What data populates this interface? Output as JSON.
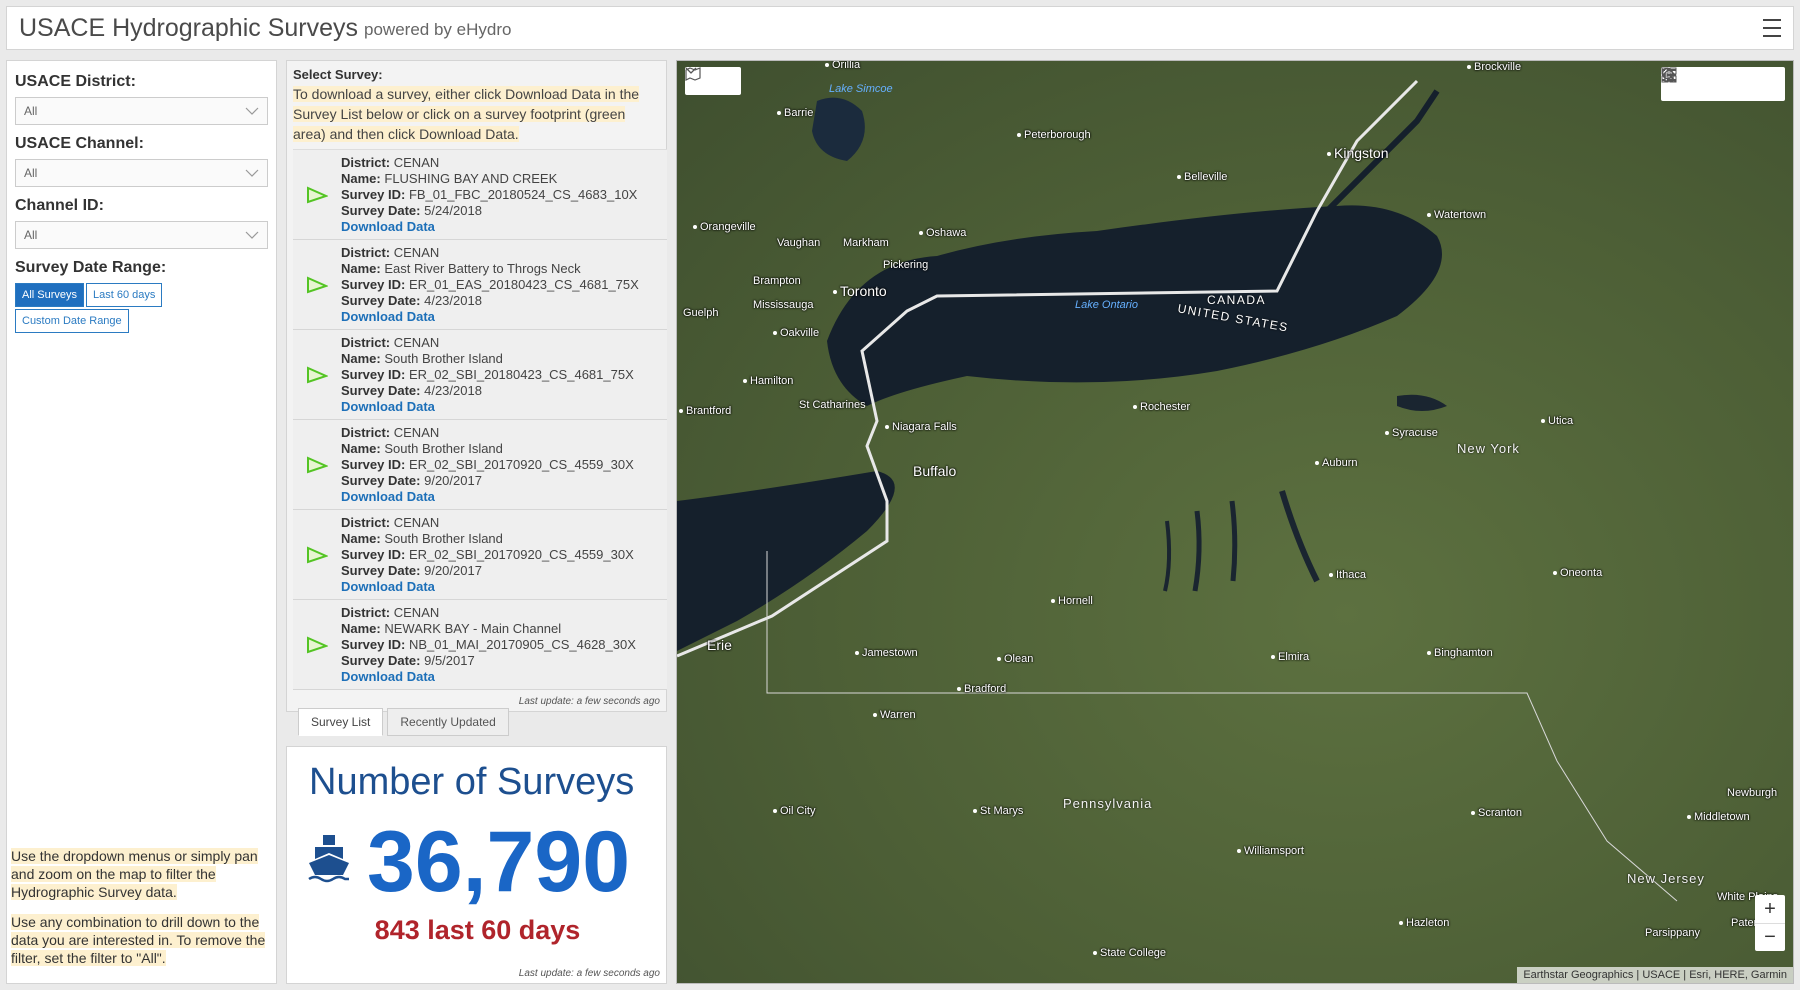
{
  "header": {
    "title": "USACE Hydrographic Surveys",
    "subtitle": "powered by eHydro"
  },
  "filters": {
    "district_label": "USACE District:",
    "district_value": "All",
    "channel_label": "USACE Channel:",
    "channel_value": "All",
    "channel_id_label": "Channel ID:",
    "channel_id_value": "All",
    "date_range_label": "Survey Date Range:",
    "btn_all": "All Surveys",
    "btn_60": "Last 60 days",
    "btn_custom": "Custom Date Range",
    "help1": "Use the dropdown menus or simply pan and zoom on the map to filter the Hydrographic Survey data.",
    "help2": "Use any combination to drill down to the data you are interested in.  To remove the filter, set the filter to \"All\"."
  },
  "survey_panel": {
    "heading": "Select Survey:",
    "instructions": "To download a survey, either click Download Data in the Survey List below or click on a survey footprint (green area) and then click Download Data.",
    "district_key": "District:",
    "name_key": "Name:",
    "id_key": "Survey ID:",
    "date_key": "Survey Date:",
    "download_label": "Download Data",
    "items": [
      {
        "district": "CENAN",
        "name": "FLUSHING BAY AND CREEK",
        "id": "FB_01_FBC_20180524_CS_4683_10X",
        "date": "5/24/2018"
      },
      {
        "district": "CENAN",
        "name": "East River Battery to Throgs Neck",
        "id": "ER_01_EAS_20180423_CS_4681_75X",
        "date": "4/23/2018"
      },
      {
        "district": "CENAN",
        "name": "South Brother Island",
        "id": "ER_02_SBI_20180423_CS_4681_75X",
        "date": "4/23/2018"
      },
      {
        "district": "CENAN",
        "name": "South Brother Island",
        "id": "ER_02_SBI_20170920_CS_4559_30X",
        "date": "9/20/2017"
      },
      {
        "district": "CENAN",
        "name": "South Brother Island",
        "id": "ER_02_SBI_20170920_CS_4559_30X",
        "date": "9/20/2017"
      },
      {
        "district": "CENAN",
        "name": "NEWARK BAY - Main Channel",
        "id": "NB_01_MAI_20170905_CS_4628_30X",
        "date": "9/5/2017"
      }
    ],
    "last_update": "Last update: a few seconds ago"
  },
  "tabs": {
    "survey_list": "Survey List",
    "recently_updated": "Recently Updated"
  },
  "counter": {
    "title": "Number of Surveys",
    "value": "36,790",
    "sub": "843 last 60 days",
    "last_update": "Last update: a few seconds ago",
    "icon": "ship-icon"
  },
  "map": {
    "lake_label": "Lake Ontario",
    "lake_simcoe": "Lake Simcoe",
    "canada": "CANADA",
    "us": "UNITED STATES",
    "pennsylvania": "Pennsylvania",
    "new_york": "New York",
    "new_jersey": "New Jersey",
    "attribution": "Earthstar Geographics | USACE | Esri, HERE, Garmin",
    "zoom_in": "+",
    "zoom_out": "−",
    "cities": {
      "orillia": "Orillia",
      "barrie": "Barrie",
      "brockville": "Brockville",
      "peterborough": "Peterborough",
      "kingston": "Kingston",
      "belleville": "Belleville",
      "orangeville": "Orangeville",
      "vaughan": "Vaughan",
      "markham": "Markham",
      "oshawa": "Oshawa",
      "pickering": "Pickering",
      "watertown": "Watertown",
      "brampton": "Brampton",
      "toronto": "Toronto",
      "mississauga": "Mississauga",
      "guelph": "Guelph",
      "oakville": "Oakville",
      "hamilton": "Hamilton",
      "brantford": "Brantford",
      "st_catharines": "St Catharines",
      "niagara_falls": "Niagara Falls",
      "buffalo": "Buffalo",
      "rochester": "Rochester",
      "syracuse": "Syracuse",
      "utica": "Utica",
      "auburn": "Auburn",
      "ithaca": "Ithaca",
      "oneonta": "Oneonta",
      "hornell": "Hornell",
      "jamestown": "Jamestown",
      "olean": "Olean",
      "elmira": "Elmira",
      "binghamton": "Binghamton",
      "erie": "Erie",
      "bradford": "Bradford",
      "warren": "Warren",
      "oil_city": "Oil City",
      "st_marys": "St Marys",
      "williamsport": "Williamsport",
      "scranton": "Scranton",
      "state_college": "State College",
      "hazleton": "Hazleton",
      "newburgh": "Newburgh",
      "middletown": "Middletown",
      "white_plains": "White Plains",
      "paterson": "Paterson",
      "parsippany": "Parsippany"
    }
  }
}
